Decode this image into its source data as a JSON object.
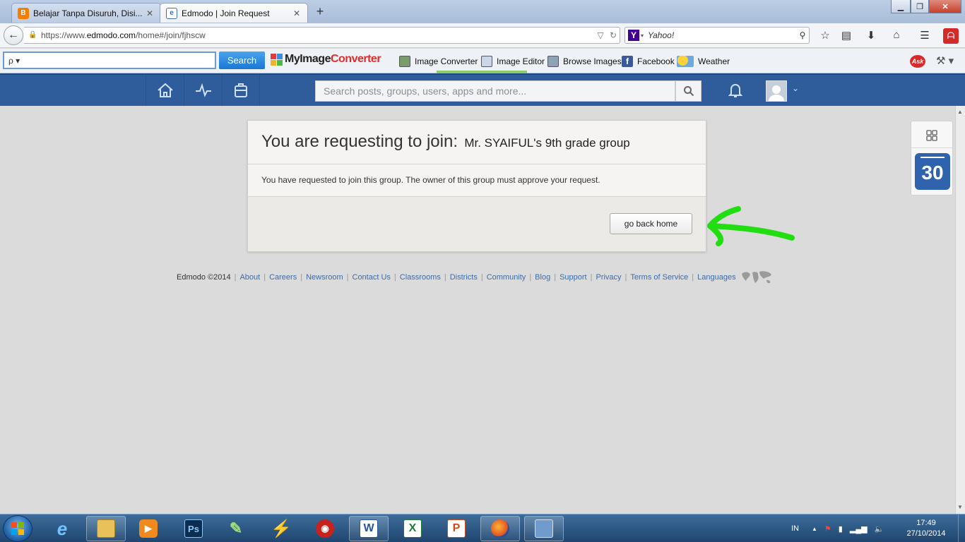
{
  "browser": {
    "tabs": [
      {
        "title": "Belajar Tanpa Disuruh, Disi...",
        "active": false
      },
      {
        "title": "Edmodo | Join Request",
        "active": true
      }
    ],
    "new_tab": "+",
    "window_buttons": [
      "minimize",
      "maximize",
      "close"
    ],
    "url": {
      "prefix": "https://www.",
      "domain": "edmodo.com",
      "path": "/home#/join/fjhscw"
    },
    "search_engine": "Yahoo!",
    "toolbar": {
      "search_prefix": "ρ ▾",
      "search_button": "Search",
      "brand": {
        "part1": "MyImage",
        "part2": "Converter"
      },
      "links": [
        "Image Converter",
        "Image Editor",
        "Browse Images",
        "Facebook",
        "Weather"
      ],
      "ask": "Ask"
    }
  },
  "edmodo": {
    "search_placeholder": "Search posts, groups, users, apps and more...",
    "nav_icons": [
      "home-icon",
      "activity-icon",
      "backpack-icon"
    ],
    "join_card": {
      "title": "You are requesting to join:",
      "group_name": "Mr. SYAIFUL's 9th grade group",
      "message": "You have requested to join this group. The owner of this group must approve your request.",
      "button": "go back home"
    },
    "footer": {
      "copyright": "Edmodo ©2014",
      "links": [
        "About",
        "Careers",
        "Newsroom",
        "Contact Us",
        "Classrooms",
        "Districts",
        "Community",
        "Blog",
        "Support",
        "Privacy",
        "Terms of Service",
        "Languages"
      ]
    },
    "calendar_day": "30",
    "accent_color": "#2f5d9c",
    "annotation_arrow_color": "#22dd11"
  },
  "taskbar": {
    "items": [
      "internet-explorer",
      "file-explorer",
      "media-player",
      "photoshop",
      "app-feather",
      "winamp",
      "app-red",
      "word",
      "excel",
      "powerpoint",
      "firefox",
      "desktop-app"
    ],
    "tray_lang": "IN",
    "time": "17:49",
    "date": "27/10/2014"
  }
}
